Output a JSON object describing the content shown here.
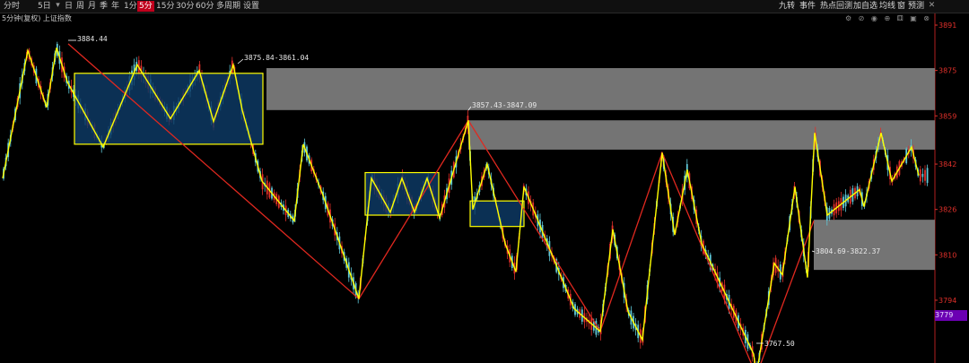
{
  "toolbar": {
    "left_items": [
      "分时",
      "5日",
      "日",
      "周",
      "月",
      "季",
      "年",
      "1分",
      "5分",
      "15分",
      "30分",
      "60分",
      "多周期",
      "设置"
    ],
    "active_item": "5分",
    "dropdown_icon": "triangle-down-icon",
    "right_items": [
      "九转",
      "事件",
      "热点回测",
      "加自选",
      "均线",
      "窗",
      "预测"
    ],
    "right_icons": [
      "settings-icon",
      "ban-icon",
      "eye-icon",
      "target-icon",
      "dice-icon",
      "lock-icon",
      "close-icon"
    ]
  },
  "subbar": {
    "label": "5分钟(复权) 上证指数",
    "tool_icons": [
      "settings-icon",
      "ban-icon",
      "eye-icon",
      "target-icon",
      "dice-icon",
      "lock-icon",
      "close-icon"
    ]
  },
  "colors": {
    "background": "#000000",
    "axis_text": "#e0302a",
    "zigzag_minor": "#ffff00",
    "zigzag_major": "#e0281f",
    "box_fill": "#0e3a66",
    "box_border": "#ffff00",
    "zone_fill": "#7a7a7a",
    "candle_up": "#e0302a",
    "candle_down": "#5fc8d8",
    "price_tag": "#6b00b3"
  },
  "chart_data": {
    "type": "candlestick",
    "title": "5分钟(复权) 上证指数",
    "ylim": [
      3767,
      3895
    ],
    "y_ticks": [
      3891,
      3875,
      3859,
      3842,
      3826,
      3810,
      3794,
      3779
    ],
    "current_price": "3779",
    "annotations": [
      {
        "text": "3884.44",
        "value": 3884.44
      },
      {
        "text": "3875.84-3861.04",
        "low": 3861.04,
        "high": 3875.84
      },
      {
        "text": "3857.43-3847.09",
        "low": 3847.09,
        "high": 3857.43
      },
      {
        "text": "3804.69-3822.37",
        "low": 3804.69,
        "high": 3822.37
      },
      {
        "text": "3767.50",
        "value": 3767.5
      }
    ],
    "major_zigzag": [
      3884.4,
      3794.5,
      3857.4,
      3783.0,
      3846.0,
      3767.5,
      3822.0
    ],
    "minor_zigzag": [
      3837.0,
      3882.0,
      3862.0,
      3883.0,
      3871.0,
      3848.0,
      3877.0,
      3858.0,
      3875.0,
      3857.0,
      3877.0,
      3861.0,
      3879.0,
      3864.0,
      3876.0,
      3852.0,
      3866.0,
      3835.0,
      3829.0,
      3860.0,
      3818.0,
      3794.5,
      3837.0,
      3825.0,
      3837.0,
      3825.0,
      3837.0,
      3823.0,
      3832.0,
      3857.4,
      3826.0,
      3842.0,
      3814.0,
      3834.0,
      3812.0,
      3834.0,
      3816.0,
      3783.0,
      3819.0,
      3780.0,
      3846.0,
      3817.0,
      3840.0,
      3814.0,
      3786.0,
      3767.5,
      3807.0,
      3802.0,
      3834.0,
      3809.0,
      3853.0,
      3824.0,
      3833.0,
      3829.0,
      3853.0,
      3836.0
    ],
    "boxes": [
      {
        "low": 3849.0,
        "high": 3874.0
      },
      {
        "low": 3824.0,
        "high": 3839.0
      },
      {
        "low": 3820.0,
        "high": 3829.0
      }
    ],
    "zones": [
      {
        "low": 3861.04,
        "high": 3875.84
      },
      {
        "low": 3847.09,
        "high": 3857.43
      },
      {
        "low": 3804.69,
        "high": 3822.37
      }
    ]
  }
}
